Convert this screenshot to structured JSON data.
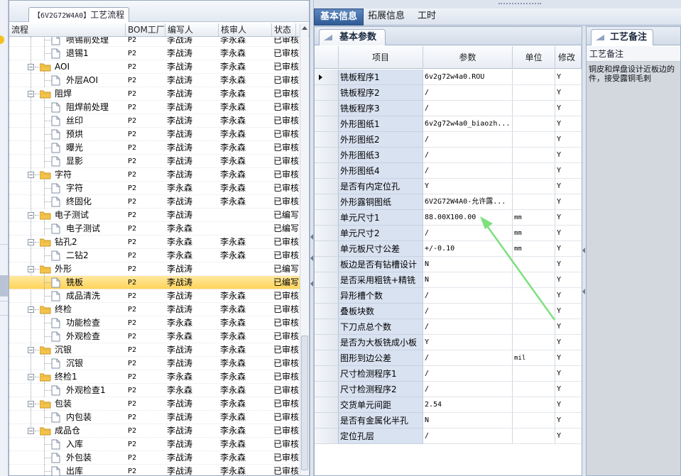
{
  "left_panel": {
    "tab_id": "【6V2G72W4A0】",
    "tab_title": "工艺流程",
    "columns": [
      "流程",
      "BOM工厂",
      "编写人",
      "核审人",
      "状态"
    ]
  },
  "tree_rows": [
    {
      "label": "喷锡前处理",
      "level": 1,
      "bom": "P2",
      "writer": "李战涛",
      "reviewer": "李永森",
      "status": "已审核",
      "partial": true
    },
    {
      "label": "退锡1",
      "level": 1,
      "bom": "P2",
      "writer": "李战涛",
      "reviewer": "李永森",
      "status": "已审核"
    },
    {
      "label": "AOI",
      "level": 0,
      "bom": "P2",
      "writer": "李战涛",
      "reviewer": "李永森",
      "status": "已审核"
    },
    {
      "label": "外层AOI",
      "level": 1,
      "bom": "P2",
      "writer": "李战涛",
      "reviewer": "李永森",
      "status": "已审核"
    },
    {
      "label": "阻焊",
      "level": 0,
      "bom": "P2",
      "writer": "李战涛",
      "reviewer": "李永森",
      "status": "已审核"
    },
    {
      "label": "阻焊前处理",
      "level": 1,
      "bom": "P2",
      "writer": "李战涛",
      "reviewer": "李永森",
      "status": "已审核"
    },
    {
      "label": "丝印",
      "level": 1,
      "bom": "P2",
      "writer": "李战涛",
      "reviewer": "李永森",
      "status": "已审核"
    },
    {
      "label": "预烘",
      "level": 1,
      "bom": "P2",
      "writer": "李战涛",
      "reviewer": "李永森",
      "status": "已审核"
    },
    {
      "label": "曝光",
      "level": 1,
      "bom": "P2",
      "writer": "李战涛",
      "reviewer": "李永森",
      "status": "已审核"
    },
    {
      "label": "显影",
      "level": 1,
      "bom": "P2",
      "writer": "李战涛",
      "reviewer": "李永森",
      "status": "已审核"
    },
    {
      "label": "字符",
      "level": 0,
      "bom": "P2",
      "writer": "李战涛",
      "reviewer": "李永森",
      "status": "已审核"
    },
    {
      "label": "字符",
      "level": 1,
      "bom": "P2",
      "writer": "李永森",
      "reviewer": "李永森",
      "status": "已审核"
    },
    {
      "label": "终固化",
      "level": 1,
      "bom": "P2",
      "writer": "李战涛",
      "reviewer": "李永森",
      "status": "已审核"
    },
    {
      "label": "电子测试",
      "level": 0,
      "bom": "P2",
      "writer": "李战涛",
      "reviewer": "",
      "status": "已编写"
    },
    {
      "label": "电子测试",
      "level": 1,
      "bom": "P2",
      "writer": "李永森",
      "reviewer": "",
      "status": "已编写"
    },
    {
      "label": "钻孔2",
      "level": 0,
      "bom": "P2",
      "writer": "李永森",
      "reviewer": "李永森",
      "status": "已审核"
    },
    {
      "label": "二钻2",
      "level": 1,
      "bom": "P2",
      "writer": "李永森",
      "reviewer": "李永森",
      "status": "已审核"
    },
    {
      "label": "外形",
      "level": 0,
      "bom": "P2",
      "writer": "李战涛",
      "reviewer": "",
      "status": "已编写"
    },
    {
      "label": "铣板",
      "level": 1,
      "bom": "P2",
      "writer": "李战涛",
      "reviewer": "",
      "status": "已编写",
      "selected": true
    },
    {
      "label": "成品清洗",
      "level": 1,
      "bom": "P2",
      "writer": "李战涛",
      "reviewer": "李永森",
      "status": "已审核"
    },
    {
      "label": "终检",
      "level": 0,
      "bom": "P2",
      "writer": "李战涛",
      "reviewer": "李永森",
      "status": "已审核"
    },
    {
      "label": "功能检查",
      "level": 1,
      "bom": "P2",
      "writer": "李永森",
      "reviewer": "李永森",
      "status": "已审核"
    },
    {
      "label": "外观检查",
      "level": 1,
      "bom": "P2",
      "writer": "李永森",
      "reviewer": "李永森",
      "status": "已审核"
    },
    {
      "label": "沉银",
      "level": 0,
      "bom": "P2",
      "writer": "李战涛",
      "reviewer": "李永森",
      "status": "已审核"
    },
    {
      "label": "沉银",
      "level": 1,
      "bom": "P2",
      "writer": "李战涛",
      "reviewer": "李永森",
      "status": "已审核"
    },
    {
      "label": "终检1",
      "level": 0,
      "bom": "P2",
      "writer": "李永森",
      "reviewer": "李永森",
      "status": "已审核"
    },
    {
      "label": "外观检查1",
      "level": 1,
      "bom": "P2",
      "writer": "李永森",
      "reviewer": "李永森",
      "status": "已审核"
    },
    {
      "label": "包装",
      "level": 0,
      "bom": "P2",
      "writer": "李战涛",
      "reviewer": "李永森",
      "status": "已审核"
    },
    {
      "label": "内包装",
      "level": 1,
      "bom": "P2",
      "writer": "李战涛",
      "reviewer": "李永森",
      "status": "已审核"
    },
    {
      "label": "成品仓",
      "level": 0,
      "bom": "P2",
      "writer": "李战涛",
      "reviewer": "李永森",
      "status": "已审核"
    },
    {
      "label": "入库",
      "level": 1,
      "bom": "P2",
      "writer": "李战涛",
      "reviewer": "李永森",
      "status": "已审核"
    },
    {
      "label": "外包装",
      "level": 1,
      "bom": "P2",
      "writer": "李战涛",
      "reviewer": "李永森",
      "status": "已审核"
    },
    {
      "label": "出库",
      "level": 1,
      "bom": "P2",
      "writer": "李战涛",
      "reviewer": "李永森",
      "status": "已审核"
    }
  ],
  "top_tabs": [
    "基本信息",
    "拓展信息",
    "工时"
  ],
  "params_panel": {
    "tab": "基本参数",
    "columns": [
      "项目",
      "参数",
      "单位",
      "修改"
    ],
    "rows": [
      {
        "item": "铣板程序1",
        "param": "6v2g72w4a0.ROU",
        "unit": "",
        "mod": "Y",
        "current": true
      },
      {
        "item": "铣板程序2",
        "param": "/",
        "unit": "",
        "mod": "Y"
      },
      {
        "item": "铣板程序3",
        "param": "/",
        "unit": "",
        "mod": "Y"
      },
      {
        "item": "外形图纸1",
        "param": "6v2g72w4a0_biaozh...",
        "unit": "",
        "mod": "Y"
      },
      {
        "item": "外形图纸2",
        "param": "/",
        "unit": "",
        "mod": "Y"
      },
      {
        "item": "外形图纸3",
        "param": "/",
        "unit": "",
        "mod": "Y"
      },
      {
        "item": "外形图纸4",
        "param": "/",
        "unit": "",
        "mod": "Y"
      },
      {
        "item": "是否有内定位孔",
        "param": "Y",
        "unit": "",
        "mod": "Y"
      },
      {
        "item": "外形露铜图纸",
        "param": "6V2G72W4A0-允许露...",
        "unit": "",
        "mod": "Y"
      },
      {
        "item": "单元尺寸1",
        "param": "88.00X100.00",
        "unit": "mm",
        "mod": "Y"
      },
      {
        "item": "单元尺寸2",
        "param": "/",
        "unit": "mm",
        "mod": "Y"
      },
      {
        "item": "单元板尺寸公差",
        "param": "+/-0.10",
        "unit": "mm",
        "mod": "Y"
      },
      {
        "item": "板边是否有钻槽设计",
        "param": "N",
        "unit": "",
        "mod": "Y"
      },
      {
        "item": "是否采用粗铣+精铣",
        "param": "N",
        "unit": "",
        "mod": "Y"
      },
      {
        "item": "异形槽个数",
        "param": "/",
        "unit": "",
        "mod": "Y"
      },
      {
        "item": "叠板块数",
        "param": "/",
        "unit": "",
        "mod": "Y"
      },
      {
        "item": "下刀点总个数",
        "param": "/",
        "unit": "",
        "mod": "Y"
      },
      {
        "item": "是否为大板铣成小板",
        "param": "Y",
        "unit": "",
        "mod": "Y"
      },
      {
        "item": "图形到边公差",
        "param": "/",
        "unit": "mil",
        "mod": "Y"
      },
      {
        "item": "尺寸检测程序1",
        "param": "/",
        "unit": "",
        "mod": "Y"
      },
      {
        "item": "尺寸检测程序2",
        "param": "/",
        "unit": "",
        "mod": "Y"
      },
      {
        "item": "交货单元间距",
        "param": "2.54",
        "unit": "",
        "mod": "Y"
      },
      {
        "item": "是否有金属化半孔",
        "param": "N",
        "unit": "",
        "mod": "Y"
      },
      {
        "item": "定位孔层",
        "param": "/",
        "unit": "",
        "mod": "Y"
      }
    ]
  },
  "notes_panel": {
    "tab": "工艺备注",
    "header": "工艺备注",
    "text": "铜皮和焊盘设计近板边的件，接受露铜毛刺"
  },
  "colors": {
    "accent_tab": "#2f5b96",
    "selection": "#ffd45a",
    "item_cell_bg": "#d9e2f1",
    "annotation_arrow": "#7de07d"
  }
}
